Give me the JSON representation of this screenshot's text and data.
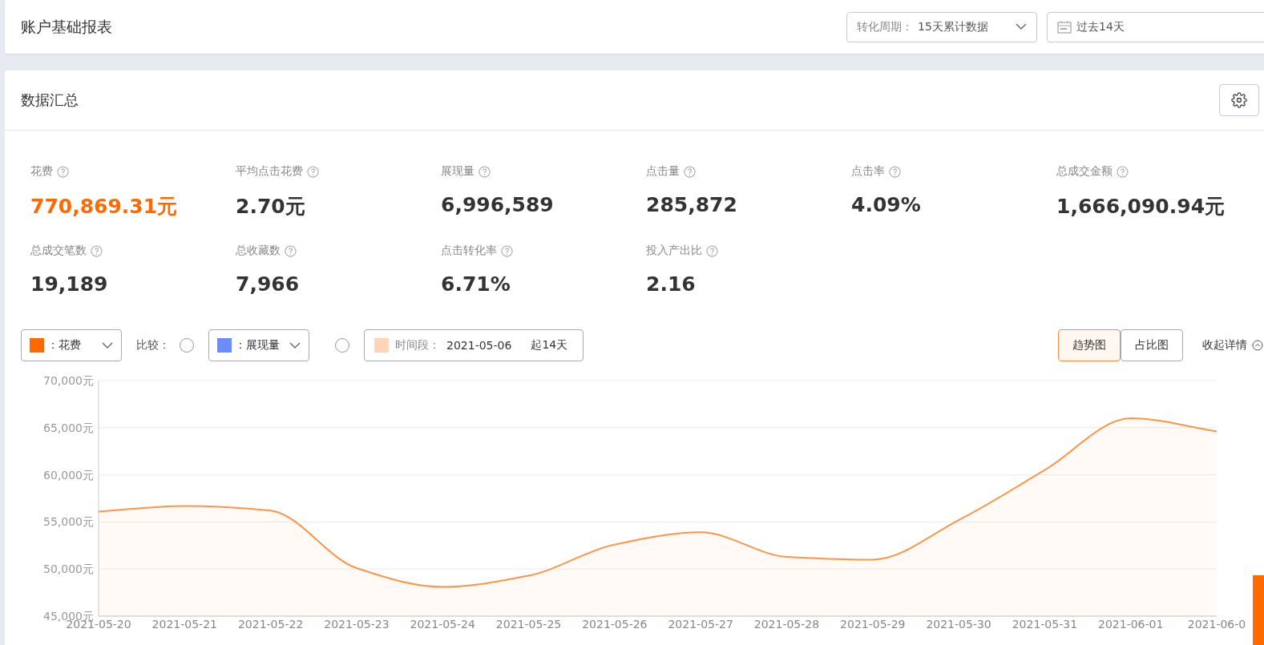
{
  "header": {
    "title": "账户基础报表",
    "cycle_select": {
      "label": "转化周期：",
      "value": "15天累计数据"
    },
    "date_select": {
      "value": "过去14天"
    }
  },
  "summary": {
    "title": "数据汇总",
    "metrics": [
      {
        "label": "花费",
        "value": "770,869.31元",
        "selected": true
      },
      {
        "label": "平均点击花费",
        "value": "2.70元",
        "selected": false
      },
      {
        "label": "展现量",
        "value": "6,996,589",
        "selected": false
      },
      {
        "label": "点击量",
        "value": "285,872",
        "selected": false
      },
      {
        "label": "点击率",
        "value": "4.09%",
        "selected": false
      },
      {
        "label": "总成交金额",
        "value": "1,666,090.94元",
        "selected": false
      },
      {
        "label": "总成交笔数",
        "value": "19,189",
        "selected": false
      },
      {
        "label": "总收藏数",
        "value": "7,966",
        "selected": false
      },
      {
        "label": "点击转化率",
        "value": "6.71%",
        "selected": false
      },
      {
        "label": "投入产出比",
        "value": "2.16",
        "selected": false
      }
    ]
  },
  "controls": {
    "metric_select": {
      "label": "：花费",
      "color": "#ff6a00"
    },
    "compare_label": "比较：",
    "compare_checked": false,
    "compare_select": {
      "label": "：展现量",
      "color": "#6b8cff"
    },
    "period_checked": false,
    "period": {
      "label": "时间段：",
      "date": "2021-05-06",
      "suffix": "起14天"
    },
    "view_tabs": [
      {
        "label": "趋势图",
        "selected": true
      },
      {
        "label": "占比图",
        "selected": false
      }
    ],
    "collapse": "收起详情"
  },
  "chart_data": {
    "type": "area",
    "categories": [
      "2021-05-20",
      "2021-05-21",
      "2021-05-22",
      "2021-05-23",
      "2021-05-24",
      "2021-05-25",
      "2021-05-26",
      "2021-05-27",
      "2021-05-28",
      "2021-05-29",
      "2021-05-30",
      "2021-05-31",
      "2021-06-01",
      "2021-06-0"
    ],
    "grid": true,
    "series": [
      {
        "color": "#ff9447",
        "values": [
          56100,
          56700,
          56200,
          50100,
          48100,
          49300,
          52600,
          53900,
          51300,
          51000,
          55200,
          60500,
          66000,
          64600
        ]
      }
    ],
    "ylim": [
      45000,
      70000
    ],
    "yticks": [
      {
        "value": 45000,
        "label": "45,000元"
      },
      {
        "value": 50000,
        "label": "50,000元"
      },
      {
        "value": 55000,
        "label": "55,000元"
      },
      {
        "value": 60000,
        "label": "60,000元"
      },
      {
        "value": 65000,
        "label": "65,000元"
      },
      {
        "value": 70000,
        "label": "70,000元"
      }
    ]
  }
}
